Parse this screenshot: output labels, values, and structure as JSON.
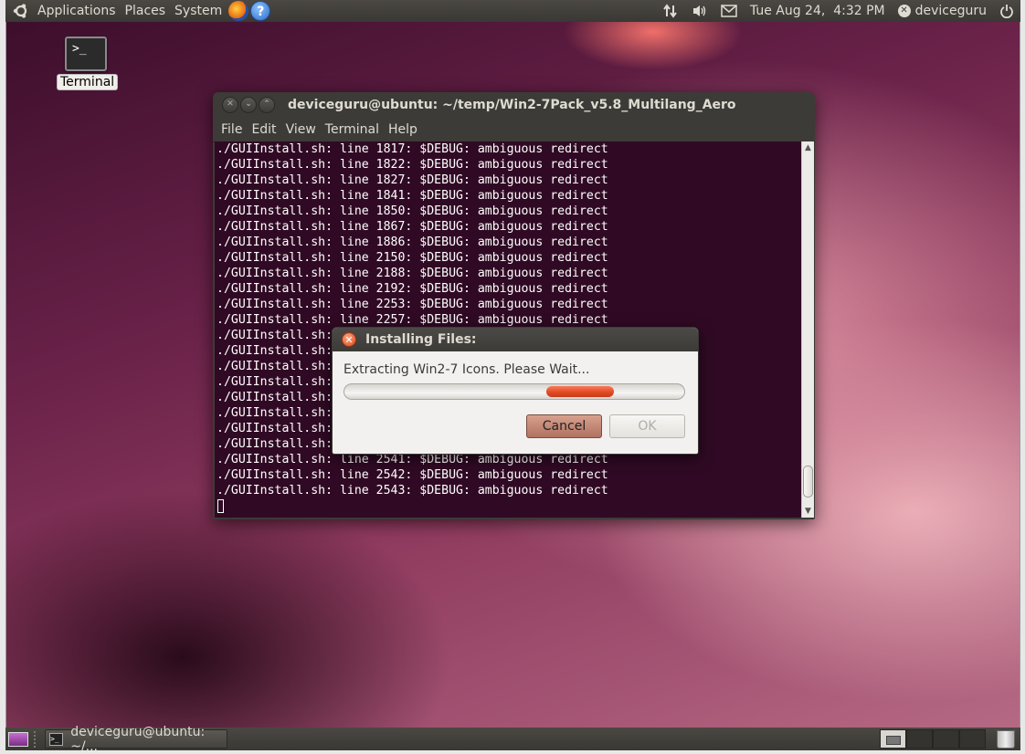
{
  "top_panel": {
    "menus": [
      "Applications",
      "Places",
      "System"
    ],
    "launchers": {
      "firefox_icon": "firefox-icon",
      "help_icon": "help-icon",
      "help_glyph": "?"
    },
    "indicators": [
      "network-icon",
      "volume-icon",
      "mail-icon"
    ],
    "clock": "Tue Aug 24,  4:32 PM",
    "user": "deviceguru"
  },
  "desktop": {
    "icon_label": "Terminal",
    "icon_glyph": ">_"
  },
  "terminal": {
    "title": "deviceguru@ubuntu: ~/temp/Win2-7Pack_v5.8_Multilang_Aero",
    "menu": [
      "File",
      "Edit",
      "View",
      "Terminal",
      "Help"
    ],
    "lines": [
      "./GUIInstall.sh: line 1817: $DEBUG: ambiguous redirect",
      "./GUIInstall.sh: line 1822: $DEBUG: ambiguous redirect",
      "./GUIInstall.sh: line 1827: $DEBUG: ambiguous redirect",
      "./GUIInstall.sh: line 1841: $DEBUG: ambiguous redirect",
      "./GUIInstall.sh: line 1850: $DEBUG: ambiguous redirect",
      "./GUIInstall.sh: line 1867: $DEBUG: ambiguous redirect",
      "./GUIInstall.sh: line 1886: $DEBUG: ambiguous redirect",
      "./GUIInstall.sh: line 2150: $DEBUG: ambiguous redirect",
      "./GUIInstall.sh: line 2188: $DEBUG: ambiguous redirect",
      "./GUIInstall.sh: line 2192: $DEBUG: ambiguous redirect",
      "./GUIInstall.sh: line 2253: $DEBUG: ambiguous redirect",
      "./GUIInstall.sh: line 2257: $DEBUG: ambiguous redirect",
      "./GUIInstall.sh:",
      "./GUIInstall.sh:",
      "./GUIInstall.sh:",
      "./GUIInstall.sh:",
      "./GUIInstall.sh:",
      "./GUIInstall.sh:",
      "./GUIInstall.sh:",
      "./GUIInstall.sh:",
      "./GUIInstall.sh: line 2541: $DEBUG: ambiguous redirect",
      "./GUIInstall.sh: line 2542: $DEBUG: ambiguous redirect",
      "./GUIInstall.sh: line 2543: $DEBUG: ambiguous redirect"
    ]
  },
  "dialog": {
    "title": "Installing Files:",
    "message": "Extracting Win2-7 Icons. Please Wait...",
    "progress_mode": "pulsing",
    "pulse_position_fraction": 0.7,
    "cancel_label": "Cancel",
    "ok_label": "OK"
  },
  "bottom_panel": {
    "task_label": "deviceguru@ubuntu: ~/...",
    "workspaces": 4,
    "active_workspace": 1
  },
  "colors": {
    "terminal_bg": "#300a24",
    "panel_bg": "#3c3b37",
    "progress_pulse": "#e24b26",
    "cancel_button": "#b07261"
  }
}
